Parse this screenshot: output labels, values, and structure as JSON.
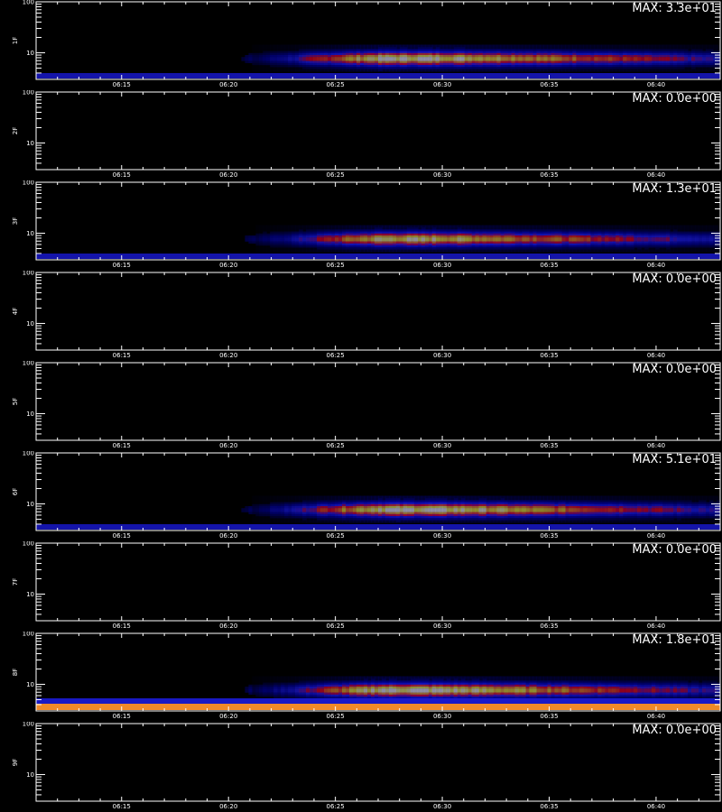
{
  "chart_data": {
    "type": "heatmap",
    "x_ticks": [
      "06:15",
      "06:20",
      "06:25",
      "06:30",
      "06:35",
      "06:40"
    ],
    "x_range": [
      "06:11",
      "06:43"
    ],
    "y_scale": "log",
    "y_range": [
      3,
      100
    ],
    "y_ticks": [
      "10",
      "100"
    ],
    "colormap": [
      "#000000",
      "#0000a0",
      "#2020ff",
      "#ff0000",
      "#ff9000",
      "#ffff00",
      "#ffffc8"
    ],
    "panels": [
      {
        "ylabel": "1F",
        "max_label": "MAX: 3.3e+01",
        "max": 33,
        "burst": {
          "start": "06:23",
          "peak": "06:27",
          "end": "06:43",
          "peak_freq": 7.5,
          "intensity": 1.0
        },
        "floor_band": "blue"
      },
      {
        "ylabel": "2F",
        "max_label": "MAX: 0.0e+00",
        "max": 0,
        "burst": null,
        "floor_band": null
      },
      {
        "ylabel": "3F",
        "max_label": "MAX: 1.3e+01",
        "max": 13,
        "burst": {
          "start": "06:23",
          "peak": "06:27",
          "end": "06:43",
          "peak_freq": 7.5,
          "intensity": 0.9
        },
        "floor_band": "blue"
      },
      {
        "ylabel": "4F",
        "max_label": "MAX: 0.0e+00",
        "max": 0,
        "burst": null,
        "floor_band": null
      },
      {
        "ylabel": "5F",
        "max_label": "MAX: 0.0e+00",
        "max": 0,
        "burst": null,
        "floor_band": null
      },
      {
        "ylabel": "6F",
        "max_label": "MAX: 5.1e+01",
        "max": 51,
        "burst": {
          "start": "06:23",
          "peak": "06:27",
          "end": "06:43",
          "peak_freq": 7.5,
          "intensity": 1.0
        },
        "floor_band": "blue"
      },
      {
        "ylabel": "7F",
        "max_label": "MAX: 0.0e+00",
        "max": 0,
        "burst": null,
        "floor_band": null
      },
      {
        "ylabel": "8F",
        "max_label": "MAX: 1.8e+01",
        "max": 18,
        "burst": {
          "start": "06:23",
          "peak": "06:27",
          "end": "06:43",
          "peak_freq": 7.5,
          "intensity": 1.0
        },
        "floor_band": "orange"
      },
      {
        "ylabel": "9F",
        "max_label": "MAX: 0.0e+00",
        "max": 0,
        "burst": null,
        "floor_band": null
      }
    ]
  }
}
